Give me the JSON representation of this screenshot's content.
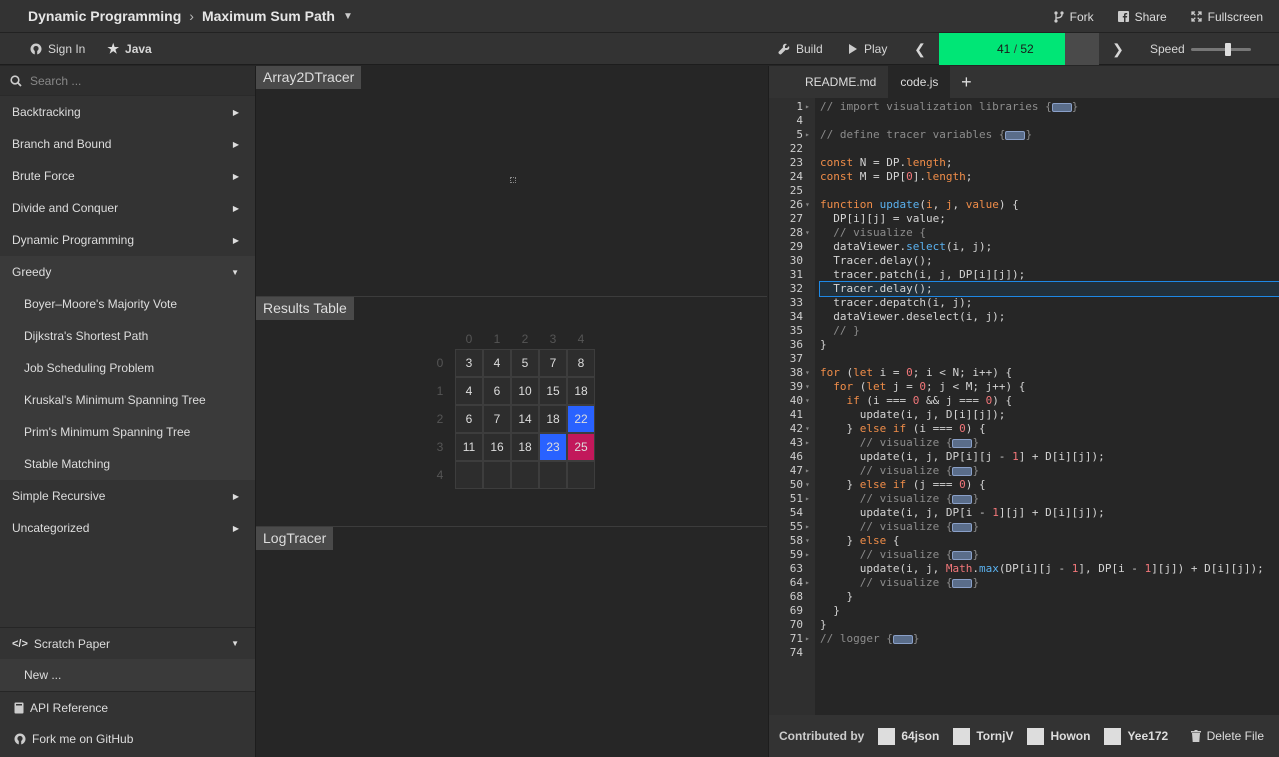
{
  "header": {
    "category": "Dynamic Programming",
    "title": "Maximum Sum Path",
    "fork": "Fork",
    "share": "Share",
    "fullscreen": "Fullscreen"
  },
  "toolbar": {
    "sign_in": "Sign In",
    "language": "Java",
    "build": "Build",
    "play": "Play",
    "step_current": "41",
    "step_total": "52",
    "step_sep": " / ",
    "progress_fraction": 0.788,
    "speed_label": "Speed",
    "speed_fraction": 0.62
  },
  "sidebar": {
    "search_placeholder": "Search ...",
    "categories": [
      {
        "label": "Backtracking"
      },
      {
        "label": "Branch and Bound"
      },
      {
        "label": "Brute Force"
      },
      {
        "label": "Divide and Conquer"
      },
      {
        "label": "Dynamic Programming"
      },
      {
        "label": "Greedy"
      }
    ],
    "greedy_items": [
      "Boyer–Moore's Majority Vote",
      "Dijkstra's Shortest Path",
      "Job Scheduling Problem",
      "Kruskal's Minimum Spanning Tree",
      "Prim's Minimum Spanning Tree",
      "Stable Matching"
    ],
    "more_categories": [
      "Simple Recursive",
      "Uncategorized"
    ],
    "scratch_paper": "Scratch Paper",
    "new_label": "New ...",
    "api_reference": "API Reference",
    "github": "Fork me on GitHub"
  },
  "panels": {
    "array2d": "Array2DTracer",
    "results": "Results Table",
    "log": "LogTracer"
  },
  "results_table": {
    "col_indices": [
      "0",
      "1",
      "2",
      "3",
      "4"
    ],
    "row_indices": [
      "0",
      "1",
      "2",
      "3",
      "4"
    ],
    "rows": [
      [
        "3",
        "4",
        "5",
        "7",
        "8"
      ],
      [
        "4",
        "6",
        "10",
        "15",
        "18"
      ],
      [
        "6",
        "7",
        "14",
        "18",
        "22"
      ],
      [
        "11",
        "16",
        "18",
        "23",
        "25"
      ],
      [
        "",
        "",
        "",
        "",
        ""
      ]
    ],
    "highlight_selected": "#2962ff",
    "highlight_patched": "#c2185b",
    "selected_cells": [
      [
        2,
        4
      ],
      [
        3,
        3
      ]
    ],
    "patched_cells": [
      [
        3,
        4
      ]
    ]
  },
  "editor": {
    "tabs": [
      "README.md",
      "code.js"
    ],
    "active_tab": "code.js",
    "current_line": "32",
    "lines": [
      {
        "n": "1",
        "fold": "closed",
        "html": "<span class=\"cm\">// import visualization libraries {</span><span class=\"pill\"></span><span class=\"cm\">}</span>"
      },
      {
        "n": "4",
        "fold": "",
        "html": ""
      },
      {
        "n": "5",
        "fold": "closed",
        "html": "<span class=\"cm\">// define tracer variables {</span><span class=\"pill\"></span><span class=\"cm\">}</span>"
      },
      {
        "n": "22",
        "fold": "",
        "html": ""
      },
      {
        "n": "23",
        "fold": "",
        "html": "<span class=\"kw\">const</span> N = DP.<span class=\"kw\">length</span>;"
      },
      {
        "n": "24",
        "fold": "",
        "html": "<span class=\"kw\">const</span> M = DP[<span class=\"nm\">0</span>].<span class=\"kw\">length</span>;"
      },
      {
        "n": "25",
        "fold": "",
        "html": ""
      },
      {
        "n": "26",
        "fold": "open",
        "html": "<span class=\"kw\">function</span> <span class=\"fn\">update</span>(<span class=\"kw\">i</span>, <span class=\"kw\">j</span>, <span class=\"kw\">value</span>) {"
      },
      {
        "n": "27",
        "fold": "",
        "html": "  DP[i][j] = value;"
      },
      {
        "n": "28",
        "fold": "open",
        "html": "  <span class=\"cm\">// visualize {</span>"
      },
      {
        "n": "29",
        "fold": "",
        "html": "  dataViewer.<span class=\"fn\">select</span>(i, j);"
      },
      {
        "n": "30",
        "fold": "",
        "html": "  Tracer.delay();"
      },
      {
        "n": "31",
        "fold": "",
        "html": "  tracer.patch(i, j, DP[i][j]);"
      },
      {
        "n": "32",
        "fold": "",
        "html": "  Tracer.delay();"
      },
      {
        "n": "33",
        "fold": "",
        "html": "  tracer.depatch(i, j);"
      },
      {
        "n": "34",
        "fold": "",
        "html": "  dataViewer.deselect(i, j);"
      },
      {
        "n": "35",
        "fold": "",
        "html": "  <span class=\"cm\">// }</span>"
      },
      {
        "n": "36",
        "fold": "",
        "html": "}"
      },
      {
        "n": "37",
        "fold": "",
        "html": ""
      },
      {
        "n": "38",
        "fold": "open",
        "html": "<span class=\"kw\">for</span> (<span class=\"kw\">let</span> i = <span class=\"nm\">0</span>; i &lt; N; i++) {"
      },
      {
        "n": "39",
        "fold": "open",
        "html": "  <span class=\"kw\">for</span> (<span class=\"kw\">let</span> j = <span class=\"nm\">0</span>; j &lt; M; j++) {"
      },
      {
        "n": "40",
        "fold": "open",
        "html": "    <span class=\"kw\">if</span> (i === <span class=\"nm\">0</span> &amp;&amp; j === <span class=\"nm\">0</span>) {"
      },
      {
        "n": "41",
        "fold": "",
        "html": "      update(i, j, D[i][j]);"
      },
      {
        "n": "42",
        "fold": "open",
        "html": "    } <span class=\"kw\">else if</span> (i === <span class=\"nm\">0</span>) {"
      },
      {
        "n": "43",
        "fold": "closed",
        "html": "      <span class=\"cm\">// visualize {</span><span class=\"pill\"></span><span class=\"cm\">}</span>"
      },
      {
        "n": "46",
        "fold": "",
        "html": "      update(i, j, DP[i][j - <span class=\"nm\">1</span>] + D[i][j]);"
      },
      {
        "n": "47",
        "fold": "closed",
        "html": "      <span class=\"cm\">// visualize {</span><span class=\"pill\"></span><span class=\"cm\">}</span>"
      },
      {
        "n": "50",
        "fold": "open",
        "html": "    } <span class=\"kw\">else if</span> (j === <span class=\"nm\">0</span>) {"
      },
      {
        "n": "51",
        "fold": "closed",
        "html": "      <span class=\"cm\">// visualize {</span><span class=\"pill\"></span><span class=\"cm\">}</span>"
      },
      {
        "n": "54",
        "fold": "",
        "html": "      update(i, j, DP[i - <span class=\"nm\">1</span>][j] + D[i][j]);"
      },
      {
        "n": "55",
        "fold": "closed",
        "html": "      <span class=\"cm\">// visualize {</span><span class=\"pill\"></span><span class=\"cm\">}</span>"
      },
      {
        "n": "58",
        "fold": "open",
        "html": "    } <span class=\"kw\">else</span> {"
      },
      {
        "n": "59",
        "fold": "closed",
        "html": "      <span class=\"cm\">// visualize {</span><span class=\"pill\"></span><span class=\"cm\">}</span>"
      },
      {
        "n": "63",
        "fold": "",
        "html": "      update(i, j, <span class=\"nm\">Math</span>.<span class=\"fn\">max</span>(DP[i][j - <span class=\"nm\">1</span>], DP[i - <span class=\"nm\">1</span>][j]) + D[i][j]);"
      },
      {
        "n": "64",
        "fold": "closed",
        "html": "      <span class=\"cm\">// visualize {</span><span class=\"pill\"></span><span class=\"cm\">}</span>"
      },
      {
        "n": "68",
        "fold": "",
        "html": "    }"
      },
      {
        "n": "69",
        "fold": "",
        "html": "  }"
      },
      {
        "n": "70",
        "fold": "",
        "html": "}"
      },
      {
        "n": "71",
        "fold": "closed",
        "html": "<span class=\"cm\">// logger {</span><span class=\"pill\"></span><span class=\"cm\">}</span>"
      },
      {
        "n": "74",
        "fold": "",
        "html": ""
      }
    ],
    "contributed_by": "Contributed by",
    "contributors": [
      "64json",
      "TornjV",
      "Howon",
      "Yee172"
    ],
    "delete_file": "Delete File"
  }
}
